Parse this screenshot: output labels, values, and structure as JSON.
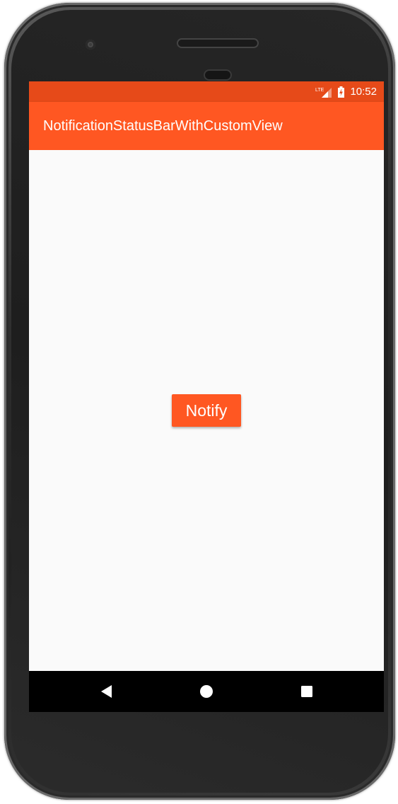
{
  "status_bar": {
    "network": "LTE",
    "time": "10:52"
  },
  "app_bar": {
    "title": "NotificationStatusBarWithCustomView"
  },
  "main": {
    "notify_label": "Notify"
  },
  "nav_bar": {
    "back_icon": "back-triangle-icon",
    "home_icon": "home-circle-icon",
    "recents_icon": "recents-square-icon"
  },
  "colors": {
    "status_bar": "#e64a19",
    "app_bar": "#ff5722",
    "button": "#ff5722",
    "background": "#fafafa",
    "nav_bar": "#000000"
  }
}
